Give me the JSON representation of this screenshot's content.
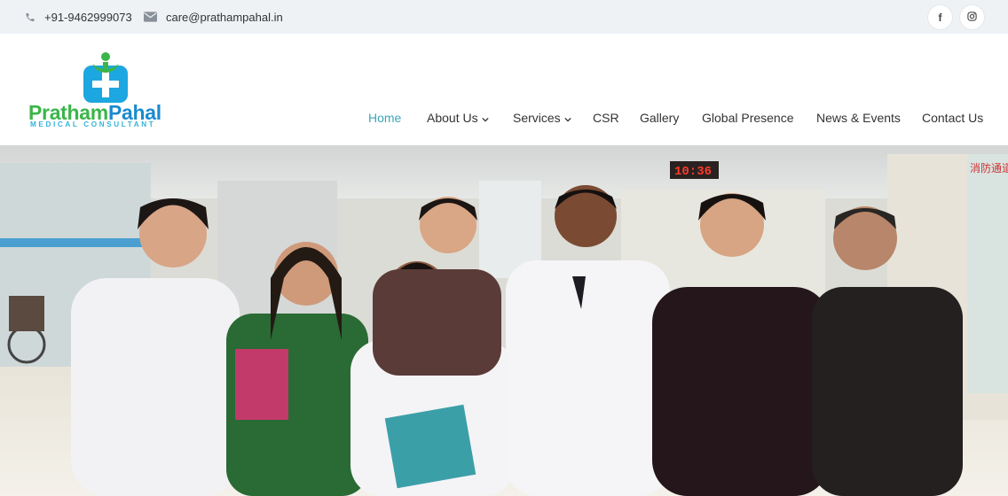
{
  "topbar": {
    "phone": "+91-9462999073",
    "email": "care@prathampahal.in",
    "social": [
      {
        "icon": "facebook-icon",
        "glyph": "f"
      },
      {
        "icon": "instagram-icon"
      }
    ]
  },
  "logo": {
    "name_part1": "Pratham",
    "name_part2": "Pahal",
    "tagline": "MEDICAL CONSULTANT"
  },
  "nav": [
    {
      "label": "Home",
      "active": true
    },
    {
      "label": "About Us",
      "dropdown": true
    },
    {
      "label": "Services",
      "dropdown": true
    },
    {
      "label": "CSR"
    },
    {
      "label": "Gallery"
    },
    {
      "label": "Global Presence"
    },
    {
      "label": "News & Events"
    },
    {
      "label": "Contact Us"
    }
  ],
  "hero": {
    "clock": "10:36",
    "wall_sign": "消防通道"
  },
  "colors": {
    "accent": "#3aa7b8",
    "logo_green": "#3bb54a",
    "logo_blue": "#1b8ad0",
    "topbar_bg": "#eef2f5"
  }
}
